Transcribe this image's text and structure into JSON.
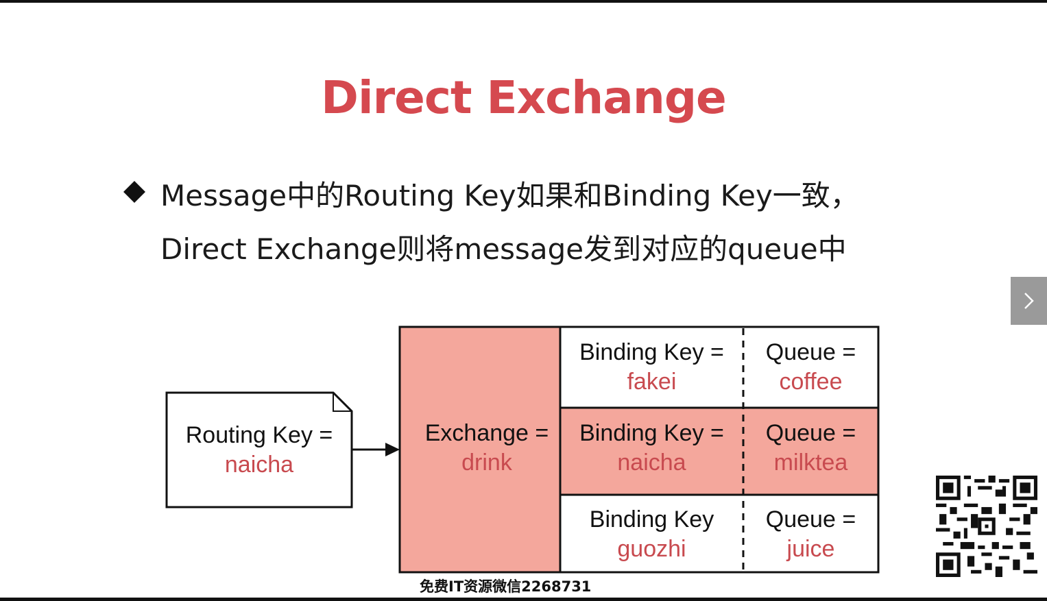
{
  "slide": {
    "title": "Direct Exchange",
    "bullet_line_1": "Message中的Routing Key如果和Binding Key一致，",
    "bullet_line_2": "Direct Exchange则将message发到对应的queue中"
  },
  "diagram": {
    "message": {
      "label": "Routing Key =",
      "value": "naicha"
    },
    "exchange": {
      "label": "Exchange =",
      "value": "drink"
    },
    "bindings": [
      {
        "binding_label": "Binding Key =",
        "binding_value": "fakei",
        "queue_label": "Queue =",
        "queue_value": "coffee",
        "highlighted": false
      },
      {
        "binding_label": "Binding Key =",
        "binding_value": "naicha",
        "queue_label": "Queue =",
        "queue_value": "milktea",
        "highlighted": true
      },
      {
        "binding_label": "Binding Key",
        "binding_value": "guozhi",
        "queue_label": "Queue =",
        "queue_value": "juice",
        "highlighted": false
      }
    ]
  },
  "overlay": {
    "watermark": "免费IT资源微信2268731",
    "next_icon": "chevron-right-icon",
    "qr_icon": "qr-code-icon"
  },
  "colors": {
    "title": "#d5494f",
    "highlight_fill": "#f4a79c",
    "value_text": "#c84a4f"
  }
}
